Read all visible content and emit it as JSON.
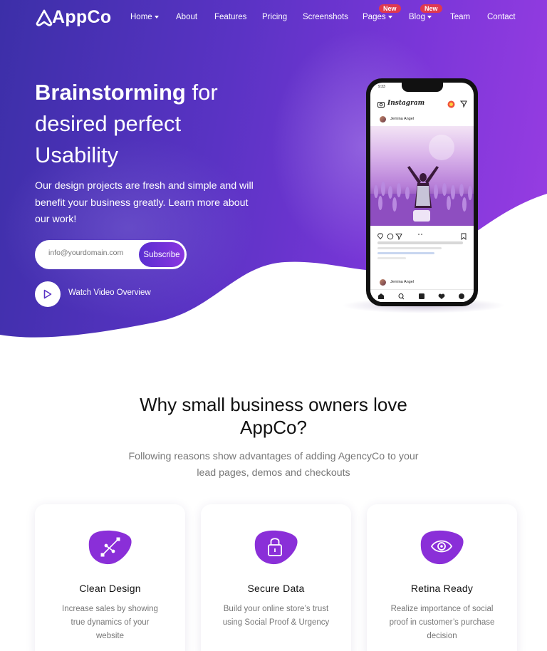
{
  "brand": {
    "name": "AppCo",
    "accent": "#7a36d8",
    "badge_color": "#e0394f"
  },
  "nav": {
    "items": [
      {
        "label": "Home",
        "dropdown": true
      },
      {
        "label": "About",
        "dropdown": false
      },
      {
        "label": "Features",
        "dropdown": false
      },
      {
        "label": "Pricing",
        "dropdown": false
      },
      {
        "label": "Screenshots",
        "dropdown": false
      },
      {
        "label": "Pages",
        "dropdown": true,
        "badge": "New"
      },
      {
        "label": "Blog",
        "dropdown": true,
        "badge": "New"
      },
      {
        "label": "Team",
        "dropdown": false
      },
      {
        "label": "Contact",
        "dropdown": false
      }
    ]
  },
  "hero": {
    "title_bold": "Brainstorming",
    "title_rest": " for desired perfect Usability",
    "description": "Our design projects are fresh and simple and will benefit your business greatly. Learn more about our work!",
    "email_placeholder": "info@yourdomain.com",
    "subscribe_label": "Subscribe",
    "video_label": "Watch Video Overview"
  },
  "phone": {
    "time": "9:33",
    "app_name": "Instagram",
    "username": "Jemina Angel",
    "comment_user": "Jemina Angel"
  },
  "features": {
    "title": "Why small business owners love AppCo?",
    "subtitle": "Following reasons show advantages of adding AgencyCo to your lead pages, demos and checkouts",
    "cards": [
      {
        "icon": "vector-pen-icon",
        "title": "Clean Design",
        "text": "Increase sales by showing true dynamics of your website"
      },
      {
        "icon": "lock-icon",
        "title": "Secure Data",
        "text": "Build your online store’s trust using Social Proof & Urgency"
      },
      {
        "icon": "eye-icon",
        "title": "Retina Ready",
        "text": "Realize importance of social proof in customer’s purchase decision"
      }
    ]
  }
}
